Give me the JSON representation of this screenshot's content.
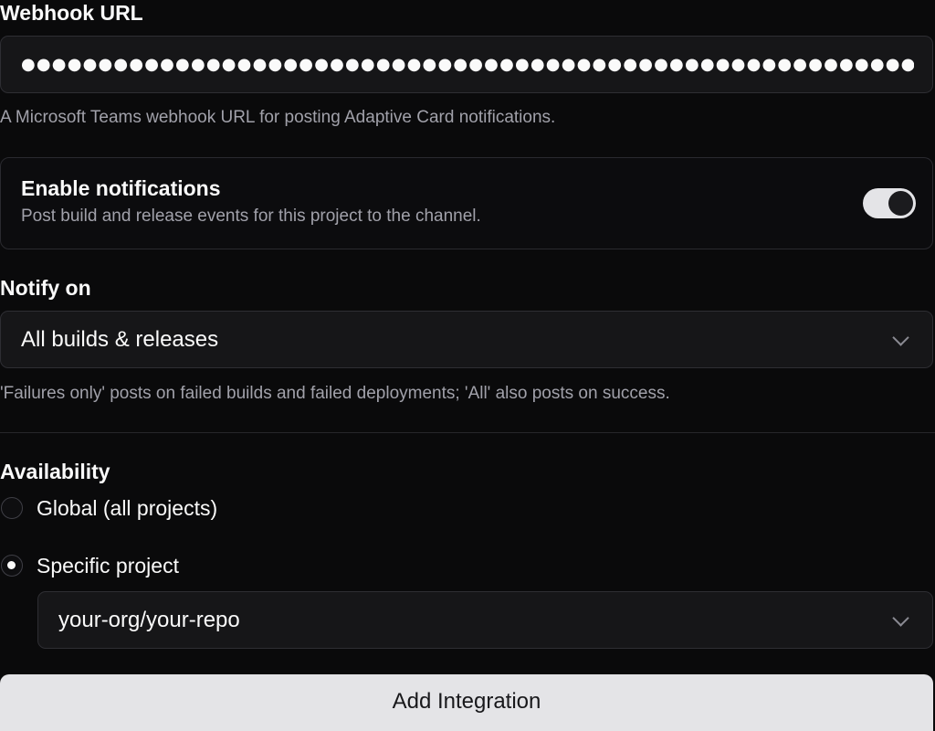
{
  "webhook": {
    "label": "Webhook URL",
    "value": "●●●●●●●●●●●●●●●●●●●●●●●●●●●●●●●●●●●●●●●●●●●●●●●●●●●●●●●●●●●●●●●●●●",
    "hint": "A Microsoft Teams webhook URL for posting Adaptive Card notifications."
  },
  "notifications": {
    "title": "Enable notifications",
    "description": "Post build and release events for this project to the channel.",
    "enabled": true
  },
  "notify_on": {
    "label": "Notify on",
    "selected": "All builds & releases",
    "hint": "'Failures only' posts on failed builds and failed deployments; 'All' also posts on success."
  },
  "availability": {
    "label": "Availability",
    "options": [
      {
        "label": "Global (all projects)",
        "checked": false
      },
      {
        "label": "Specific project",
        "checked": true
      }
    ],
    "project_selected": "your-org/your-repo"
  },
  "actions": {
    "submit_label": "Add Integration"
  },
  "colors": {
    "background": "#0a0a0b",
    "input_background": "#161618",
    "button_background": "#e4e4e7",
    "muted_text": "#a1a1aa"
  }
}
